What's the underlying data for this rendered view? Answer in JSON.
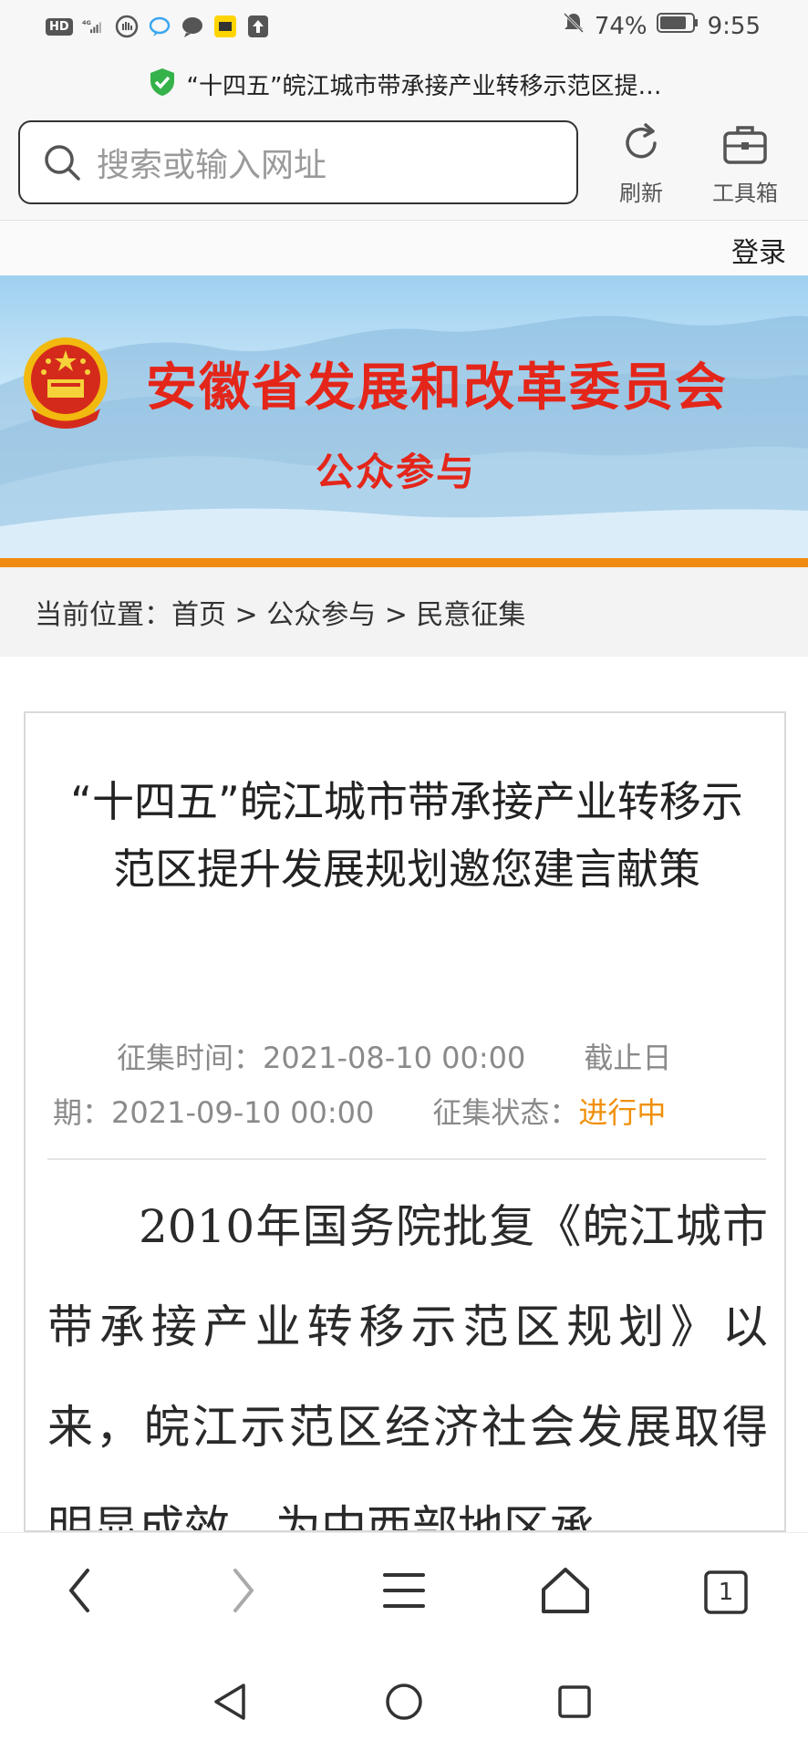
{
  "status_bar": {
    "hd_label": "HD",
    "network_label": "4G",
    "battery": "74%",
    "time": "9:55",
    "icons": [
      "hd-icon",
      "signal-icon",
      "hand-icon",
      "chat-bubble-icon",
      "message-icon",
      "app-icon",
      "upload-icon",
      "mute-bell-icon",
      "battery-icon"
    ]
  },
  "browser": {
    "page_title": "“十四五”皖江城市带承接产业转移示范区提…",
    "search_placeholder": "搜索或输入网址",
    "refresh_label": "刷新",
    "toolbox_label": "工具箱",
    "tab_count": "1"
  },
  "site": {
    "login": "登录",
    "org_name": "安徽省发展和改革委员会",
    "section": "公众参与",
    "breadcrumb": "当前位置：首页 > 公众参与 > 民意征集",
    "accent_color": "#e4261a",
    "stripe_color": "#f08a10"
  },
  "article": {
    "title": "“十四五”皖江城市带承接产业转移示范区提升发展规划邀您建言献策",
    "meta_line1": "征集时间：2021-08-10 00:00　　截止日",
    "meta_line2_prefix": "期：2021-09-10 00:00　　征集状态：",
    "status": "进行中",
    "status_color": "#f0900a",
    "body": "2010年国务院批复《皖江城市带承接产业转移示范区规划》以来，皖江示范区经济社会发展取得明显成效，为中西部地区承"
  }
}
